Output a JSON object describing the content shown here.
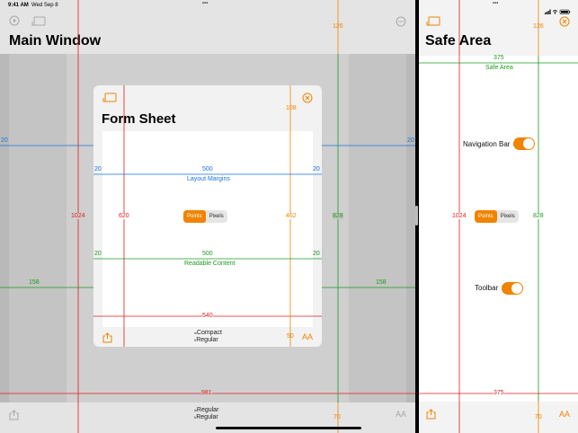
{
  "status_bar": {
    "time": "9:41 AM",
    "date": "Wed Sep 8",
    "multitask_dots": "•••"
  },
  "main_window": {
    "title": "Main Window",
    "size_classes": {
      "line1": "Regular",
      "line2": "Regular",
      "prefix1": "w",
      "prefix2": "h"
    },
    "aa_label": "AA"
  },
  "form_sheet": {
    "title": "Form Sheet",
    "segment": [
      "Points",
      "Pixels"
    ],
    "selected_segment": "Points",
    "size_classes": {
      "line1": "Compact",
      "line2": "Regular",
      "prefix1": "w",
      "prefix2": "h"
    },
    "aa_label": "AA"
  },
  "safe_area_window": {
    "title": "Safe Area",
    "section_label": "Safe Area",
    "navigation_bar_label": "Navigation Bar",
    "navigation_bar_on": true,
    "toolbar_label": "Toolbar",
    "toolbar_on": true,
    "segment": [
      "Points",
      "Pixels"
    ],
    "selected_segment": "Points",
    "aa_label": "AA"
  },
  "measurements": {
    "main_top": "126",
    "main_height": "1024",
    "main_width": "981",
    "main_bottom": "70",
    "main_margin_left": "20",
    "main_margin_right": "20",
    "main_side_left": "158",
    "main_side_right": "158",
    "sheet_top": "108",
    "sheet_height": "620",
    "sheet_safe_height": "462",
    "sheet_width": "540",
    "sheet_bottom": "50",
    "layout_margin_width": "500",
    "layout_margin_left": "20",
    "layout_margin_right": "20",
    "layout_margins_label": "Layout Margins",
    "readable_width": "500",
    "readable_left": "20",
    "readable_right": "20",
    "readable_content_label": "Readable Content",
    "main_safe_height": "828",
    "right_top": "126",
    "right_width": "375",
    "right_height": "1024",
    "right_safe_height": "828",
    "right_bottom_width": "375",
    "right_bottom": "70"
  }
}
